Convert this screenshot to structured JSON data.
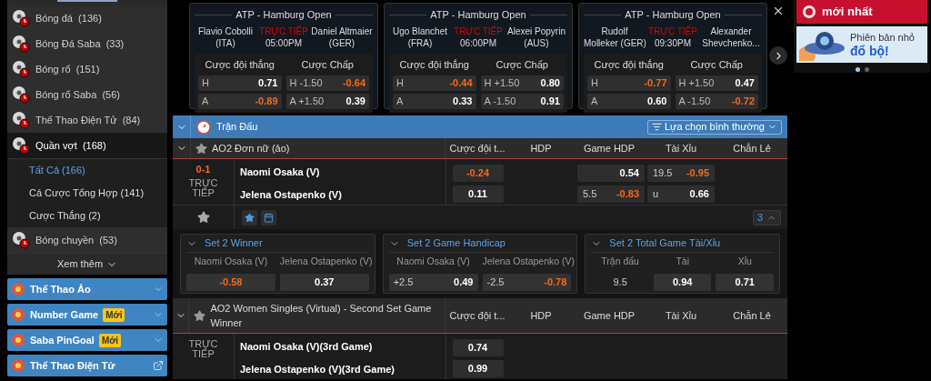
{
  "sidebar": {
    "sports": [
      {
        "label": "Bóng đá",
        "count": "(136)",
        "selected": false
      },
      {
        "label": "Bóng Đá Saba",
        "count": "(33)",
        "selected": false
      },
      {
        "label": "Bóng rổ",
        "count": "(151)",
        "selected": false
      },
      {
        "label": "Bóng rổ Saba",
        "count": "(56)",
        "selected": false
      },
      {
        "label": "Thể Thao Điện Tử",
        "count": "(84)",
        "selected": false
      },
      {
        "label": "Quần vợt",
        "count": "(168)",
        "selected": true,
        "children": [
          {
            "label": "Tất Cả",
            "count": "(166)",
            "selected": true
          },
          {
            "label": "Cá Cược Tổng Hợp",
            "count": "(141)",
            "selected": false
          },
          {
            "label": "Cược Thắng",
            "count": "(2)",
            "selected": false
          }
        ]
      },
      {
        "label": "Bóng chuyền",
        "count": "(53)",
        "selected": false
      }
    ],
    "more": "Xem thêm",
    "panels": [
      {
        "label": "Thể Thao Ảo",
        "kind": "expand"
      },
      {
        "label": "Number Game",
        "badge": "Mới",
        "kind": "expand"
      },
      {
        "label": "Saba PinGoal",
        "badge": "Mới",
        "kind": "expand"
      },
      {
        "label": "Thể Thao Điện Tử",
        "kind": "link"
      }
    ]
  },
  "featured": {
    "cards": [
      {
        "league": "ATP - Hamburg Open",
        "home": [
          "Flavio Cobolli",
          "(ITA)"
        ],
        "status": "TRỰC TIẾP",
        "time": "05:00PM",
        "away": [
          "Daniel Altmaier",
          "(GER)"
        ],
        "headers": [
          "Cược đội thắng",
          "Cược Chấp"
        ],
        "win": [
          {
            "side": "H",
            "value": "0.71",
            "highlight": false
          },
          {
            "side": "A",
            "value": "-0.89",
            "highlight": true
          }
        ],
        "handicap": [
          {
            "side": "H -1.50",
            "value": "-0.64",
            "highlight": true
          },
          {
            "side": "A +1.50",
            "value": "0.39",
            "highlight": false
          }
        ]
      },
      {
        "league": "ATP - Hamburg Open",
        "home": [
          "Ugo Blanchet",
          "(FRA)"
        ],
        "status": "TRỰC TIẾP",
        "time": "06:00PM",
        "away": [
          "Alexei Popyrin",
          "(AUS)"
        ],
        "headers": [
          "Cược đội thắng",
          "Cược Chấp"
        ],
        "win": [
          {
            "side": "H",
            "value": "-0.44",
            "highlight": true
          },
          {
            "side": "A",
            "value": "0.33",
            "highlight": false
          }
        ],
        "handicap": [
          {
            "side": "H +1.50",
            "value": "0.80",
            "highlight": false
          },
          {
            "side": "A -1.50",
            "value": "0.91",
            "highlight": false
          }
        ]
      },
      {
        "league": "ATP - Hamburg Open",
        "home": [
          "Rudolf",
          "Molleker (GER)"
        ],
        "status": "TRỰC TIẾP",
        "time": "09:30PM",
        "away": [
          "Alexander",
          "Shevchenko..."
        ],
        "headers": [
          "Cược đội thắng",
          "Cược Chấp"
        ],
        "win": [
          {
            "side": "H",
            "value": "-0.77",
            "highlight": true
          },
          {
            "side": "A",
            "value": "0.60",
            "highlight": false
          }
        ],
        "handicap": [
          {
            "side": "H +1.50",
            "value": "0.47",
            "highlight": false
          },
          {
            "side": "A -1.50",
            "value": "-0.72",
            "highlight": true
          }
        ]
      }
    ]
  },
  "banners": [
    {
      "text": [
        "mới nhất"
      ]
    },
    {
      "text": [
        "Phiên bản nhỏ",
        "đổ bộ!"
      ]
    }
  ],
  "section": {
    "title": "Trận Đấu",
    "sort": "Lựa chọn bình thường"
  },
  "leagues": [
    {
      "name": "AO2 Đơn nữ (ảo)",
      "columns": [
        "Cược đội t...",
        "HDP",
        "Game HDP",
        "Tài Xỉu",
        "Chẵn Lẻ"
      ],
      "matches": [
        {
          "score": "0-1",
          "status": "TRỰC TIẾP",
          "teams": [
            "Naomi Osaka (V)",
            "Jelena Ostapenko (V)"
          ],
          "moneyline": [
            {
              "value": "-0.24",
              "highlight": true
            },
            {
              "value": "0.11",
              "highlight": false
            }
          ],
          "game_hdp": [
            {
              "value": "0.54",
              "highlight": false
            },
            {
              "line": "5.5",
              "value": "-0.83",
              "highlight": true
            }
          ],
          "total": [
            {
              "line": "19.5",
              "value": "-0.95",
              "highlight": true
            },
            {
              "line": "u",
              "value": "0.66",
              "highlight": false
            }
          ],
          "more": "3"
        }
      ],
      "markets": [
        {
          "title": "Set 2 Winner",
          "kind": "pair",
          "labels": [
            "Naomi Osaka (V)",
            "Jelena Ostapenko (V)"
          ],
          "odds": [
            {
              "value": "-0.58",
              "highlight": true
            },
            {
              "value": "0.37",
              "highlight": false
            }
          ]
        },
        {
          "title": "Set 2 Game Handicap",
          "kind": "pair",
          "labels": [
            "Naomi Osaka (V)",
            "Jelena Ostapenko (V)"
          ],
          "odds": [
            {
              "line": "+2.5",
              "value": "0.49",
              "highlight": false
            },
            {
              "line": "-2.5",
              "value": "-0.78",
              "highlight": true
            }
          ]
        },
        {
          "title": "Set 2 Total Game Tài/Xỉu",
          "kind": "total",
          "labels": [
            "Trận đấu",
            "Tài",
            "Xỉu"
          ],
          "line": "9.5",
          "odds": [
            {
              "value": "0.94",
              "highlight": false
            },
            {
              "value": "0.71",
              "highlight": false
            }
          ]
        }
      ]
    },
    {
      "name": "AO2 Women Singles (Virtual) - Second Set Game Winner",
      "columns": [
        "Cược đội t...",
        "HDP",
        "Game HDP",
        "Tài Xỉu",
        "Chẵn Lẻ"
      ],
      "matches": [
        {
          "status": "TRỰC TIẾP",
          "teams": [
            "Naomi Osaka (V)(3rd Game)",
            "Jelena Ostapenko (V)(3rd Game)"
          ],
          "moneyline": [
            {
              "value": "0.74",
              "highlight": false
            },
            {
              "value": "0.99",
              "highlight": false
            }
          ]
        }
      ]
    }
  ]
}
